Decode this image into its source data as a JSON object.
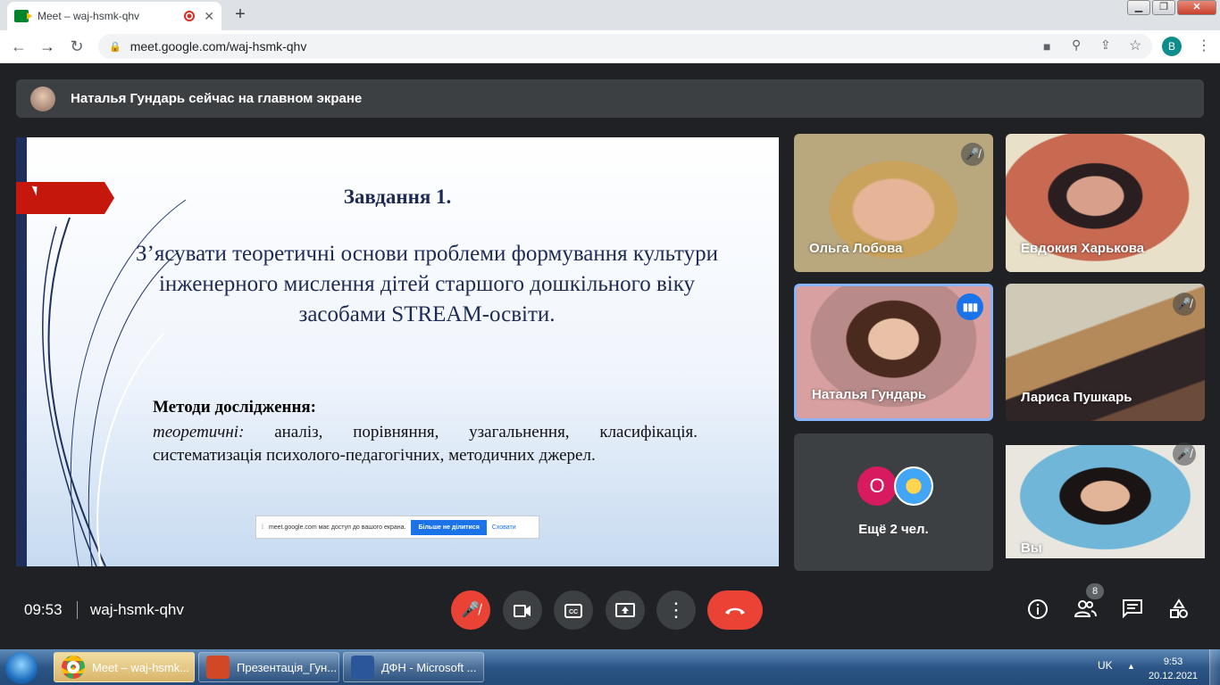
{
  "browser": {
    "tab_title": "Meet – waj-hsmk-qhv",
    "tab_close": "✕",
    "new_tab": "+",
    "url": "meet.google.com/waj-hsmk-qhv",
    "profile_initial": "B",
    "window_min": "▁",
    "window_max": "❐",
    "window_close": "✕"
  },
  "meet": {
    "presenting_text": "Наталья Гундарь сейчас на главном экране",
    "slide": {
      "title": "Завдання 1.",
      "task": "З’ясувати теоретичні основи проблеми формування культури інженерного мислення дітей старшого дошкільного віку засобами STREAM-освіти.",
      "methods_heading": "Методи дослідження:",
      "methods_italic": "теоретичні:",
      "methods_text": " аналіз, порівняння, узагальнення, класифікація. систематизація психолого-педагогічних, методичних джерел."
    },
    "share_notice": {
      "text": "meet.google.com має доступ до вашого екрана.",
      "stop_label": "Більше не ділитися",
      "hide_label": "Сховати"
    },
    "participants": [
      {
        "name": "Ольга Лобова",
        "muted": true
      },
      {
        "name": "Евдокия Харькова",
        "muted": false
      },
      {
        "name": "Наталья Гундарь",
        "muted": false,
        "speaking": true
      },
      {
        "name": "Лариса Пушкарь",
        "muted": true
      },
      {
        "name": "Вы",
        "muted": true
      }
    ],
    "more_participants": {
      "avatar_letter": "O",
      "label": "Ещё 2 чел."
    },
    "time": "09:53",
    "meeting_code": "waj-hsmk-qhv",
    "people_count": "8",
    "colors": {
      "end_call": "#ea4335",
      "mic_off": "#ea4335",
      "active_border": "#8ab4f8",
      "speaker": "#1a73e8"
    }
  },
  "taskbar": {
    "items": [
      {
        "label": "Meet – waj-hsmk...",
        "icon": "chrome-icon"
      },
      {
        "label": "Презентація_Гун...",
        "icon": "powerpoint-icon"
      },
      {
        "label": "ДФН - Microsoft ...",
        "icon": "word-icon"
      }
    ],
    "language": "UK",
    "clock_time": "9:53",
    "clock_date": "20.12.2021"
  }
}
